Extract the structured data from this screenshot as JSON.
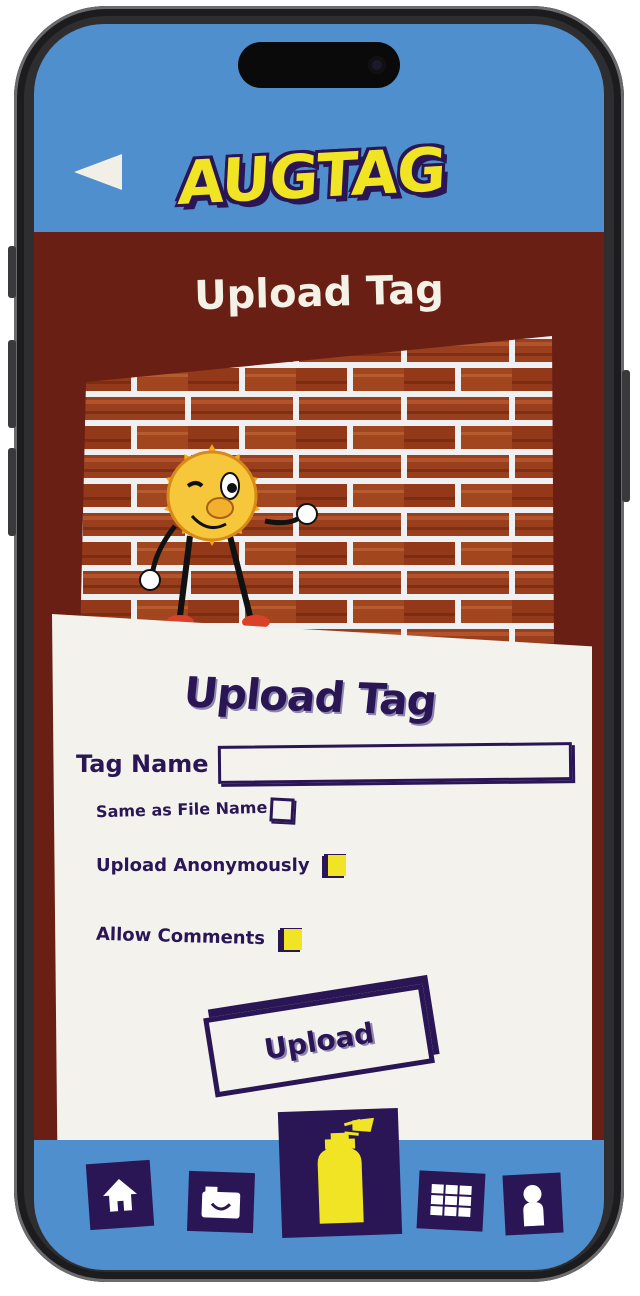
{
  "app": {
    "logo_text": "AUGTAG"
  },
  "header": {
    "back_icon": "back-arrow-icon"
  },
  "page": {
    "title": "Upload Tag"
  },
  "preview": {
    "image": "brick-wall-with-sun-mascot-tag"
  },
  "form": {
    "title": "Upload Tag",
    "tag_name_label": "Tag Name",
    "tag_name_value": "",
    "same_as_file_label": "Same as File Name",
    "same_as_file_checked": false,
    "anonymous_label": "Upload Anonymously",
    "anonymous_checked": true,
    "comments_label": "Allow Comments",
    "comments_checked": true,
    "upload_button": "Upload"
  },
  "nav": {
    "items": [
      {
        "icon": "home-icon"
      },
      {
        "icon": "camera-icon"
      },
      {
        "icon": "spray-can-icon",
        "active": true
      },
      {
        "icon": "gallery-grid-icon"
      },
      {
        "icon": "profile-icon"
      }
    ]
  },
  "colors": {
    "header_blue": "#4f8fcd",
    "background_maroon": "#6a1f14",
    "accent_yellow": "#f0e424",
    "ink_purple": "#2a1655",
    "card_cream": "#f3f2ec"
  }
}
